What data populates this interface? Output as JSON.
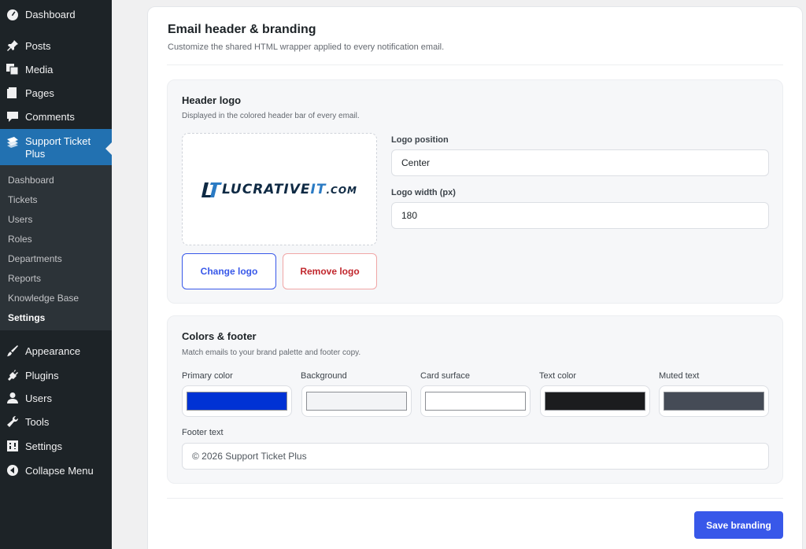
{
  "sidebar": {
    "menu": [
      {
        "label": "Dashboard",
        "icon": "dashboard-icon"
      },
      {
        "label": "Posts",
        "icon": "pin-icon"
      },
      {
        "label": "Media",
        "icon": "media-icon"
      },
      {
        "label": "Pages",
        "icon": "pages-icon"
      },
      {
        "label": "Comments",
        "icon": "comment-icon"
      }
    ],
    "active": {
      "label": "Support Ticket Plus",
      "icon": "ticket-icon"
    },
    "submenu": [
      "Dashboard",
      "Tickets",
      "Users",
      "Roles",
      "Departments",
      "Reports",
      "Knowledge Base",
      "Settings"
    ],
    "current_submenu": "Settings",
    "menu_bottom": [
      {
        "label": "Appearance",
        "icon": "brush-icon"
      },
      {
        "label": "Plugins",
        "icon": "plugin-icon"
      },
      {
        "label": "Users",
        "icon": "user-icon"
      },
      {
        "label": "Tools",
        "icon": "wrench-icon"
      },
      {
        "label": "Settings",
        "icon": "settings-icon"
      },
      {
        "label": "Collapse Menu",
        "icon": "collapse-icon"
      }
    ]
  },
  "page": {
    "title": "Email header & branding",
    "subtitle": "Customize the shared HTML wrapper applied to every notification email."
  },
  "header_logo": {
    "title": "Header logo",
    "subtitle": "Displayed in the colored header bar of every email.",
    "logo": {
      "lt": "LT",
      "main": "LUCRATIVE",
      "it": "IT",
      "com": ".COM"
    },
    "change_label": "Change logo",
    "remove_label": "Remove logo",
    "position_label": "Logo position",
    "position_value": "Center",
    "width_label": "Logo width (px)",
    "width_value": "180"
  },
  "colors_footer": {
    "title": "Colors & footer",
    "subtitle": "Match emails to your brand palette and footer copy.",
    "swatches": [
      {
        "label": "Primary color",
        "color": "#0032d4"
      },
      {
        "label": "Background",
        "color": "#f3f4f6"
      },
      {
        "label": "Card surface",
        "color": "#ffffff"
      },
      {
        "label": "Text color",
        "color": "#1b1c1e"
      },
      {
        "label": "Muted text",
        "color": "#454b56"
      }
    ],
    "footer_label": "Footer text",
    "footer_value": "© 2026 Support Ticket Plus"
  },
  "save_label": "Save branding",
  "colors": {
    "accent": "#3858e9",
    "wp_blue": "#2271b1",
    "sidebar": "#1d2327"
  }
}
